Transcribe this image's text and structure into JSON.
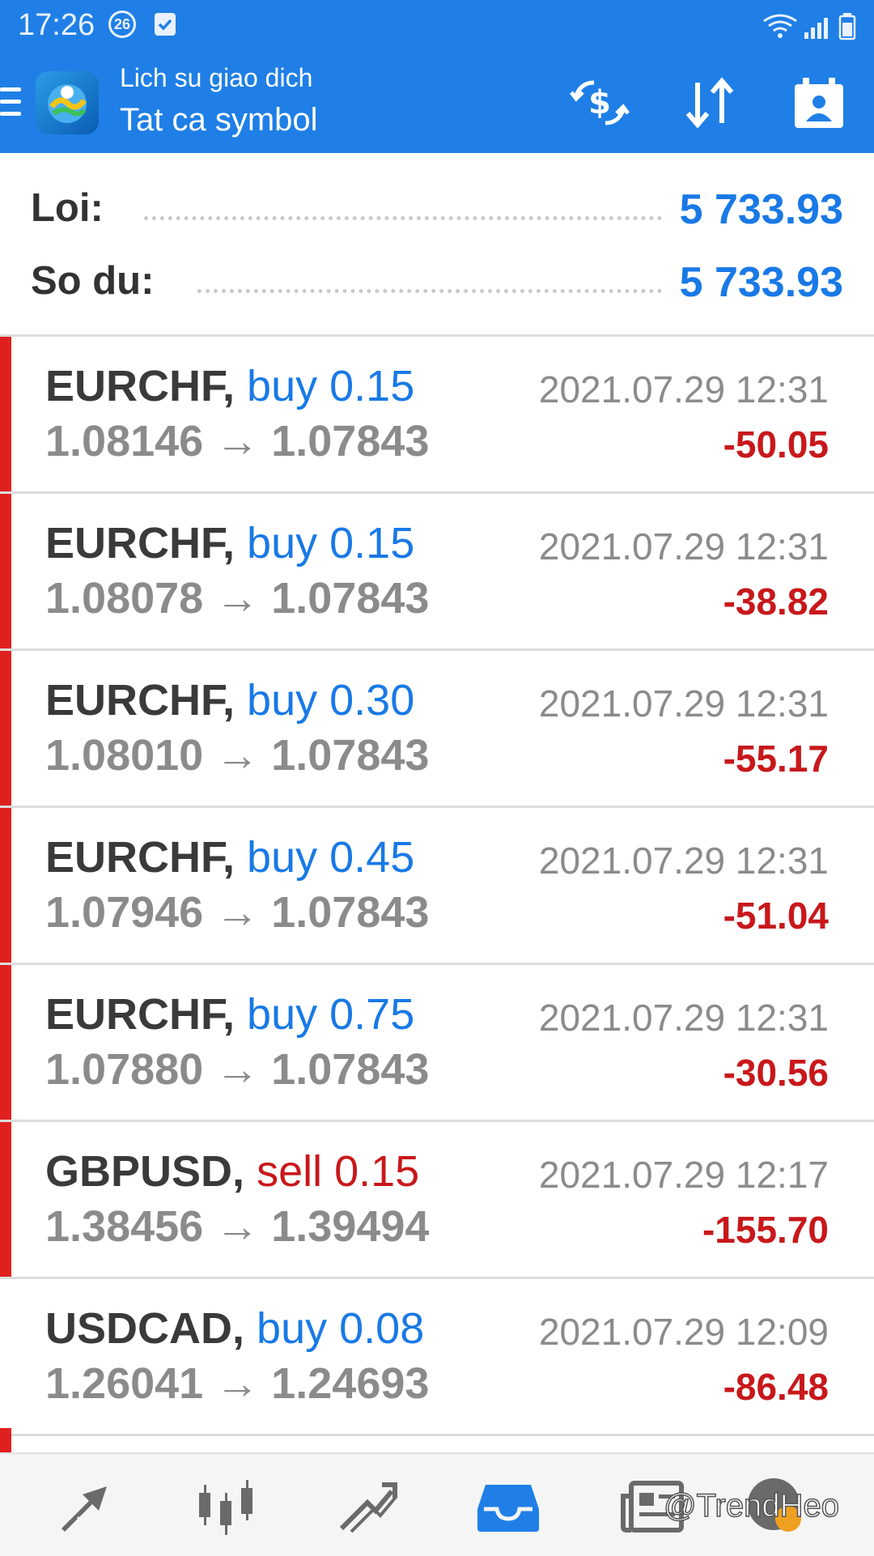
{
  "status_bar": {
    "time": "17:26",
    "badge": "26",
    "icons": [
      "notification-badge-icon",
      "checkbox-notification-icon",
      "wifi-icon",
      "signal-icon",
      "battery-icon"
    ]
  },
  "app_bar": {
    "menu_icon": "hamburger-menu-icon",
    "logo_icon": "metatrader-logo-icon",
    "title": "Lich su giao dich",
    "subtitle": "Tat ca symbol",
    "actions": [
      "currency-exchange-icon",
      "sort-icon",
      "calendar-period-icon"
    ]
  },
  "summary": {
    "profit_label": "Loi:",
    "profit_value": "5 733.93",
    "balance_label": "So du:",
    "balance_value": "5 733.93"
  },
  "deals": [
    {
      "symbol": "EURCHF,",
      "type": "buy",
      "volume": "0.15",
      "open_price": "1.08146",
      "close_price": "1.07843",
      "time": "2021.07.29 12:31",
      "profit": "-50.05"
    },
    {
      "symbol": "EURCHF,",
      "type": "buy",
      "volume": "0.15",
      "open_price": "1.08078",
      "close_price": "1.07843",
      "time": "2021.07.29 12:31",
      "profit": "-38.82"
    },
    {
      "symbol": "EURCHF,",
      "type": "buy",
      "volume": "0.30",
      "open_price": "1.08010",
      "close_price": "1.07843",
      "time": "2021.07.29 12:31",
      "profit": "-55.17"
    },
    {
      "symbol": "EURCHF,",
      "type": "buy",
      "volume": "0.45",
      "open_price": "1.07946",
      "close_price": "1.07843",
      "time": "2021.07.29 12:31",
      "profit": "-51.04"
    },
    {
      "symbol": "EURCHF,",
      "type": "buy",
      "volume": "0.75",
      "open_price": "1.07880",
      "close_price": "1.07843",
      "time": "2021.07.29 12:31",
      "profit": "-30.56"
    },
    {
      "symbol": "GBPUSD,",
      "type": "sell",
      "volume": "0.15",
      "open_price": "1.38456",
      "close_price": "1.39494",
      "time": "2021.07.29 12:17",
      "profit": "-155.70"
    },
    {
      "symbol": "USDCAD,",
      "type": "buy",
      "volume": "0.08",
      "open_price": "1.26041",
      "close_price": "1.24693",
      "time": "2021.07.29 12:09",
      "profit": "-86.48"
    }
  ],
  "arrow": "→",
  "colors": {
    "header": "#1f7fe6",
    "buy": "#1979e6",
    "sell": "#c8181b",
    "loss": "#c8181b",
    "loss_bar": "#e0201f"
  },
  "bottom_nav": {
    "items": [
      "quotes-icon",
      "chart-candles-icon",
      "trade-icon",
      "history-inbox-icon",
      "news-icon",
      "chat-icon"
    ],
    "active": "history-inbox-icon"
  },
  "watermark": "@TrendHeo"
}
